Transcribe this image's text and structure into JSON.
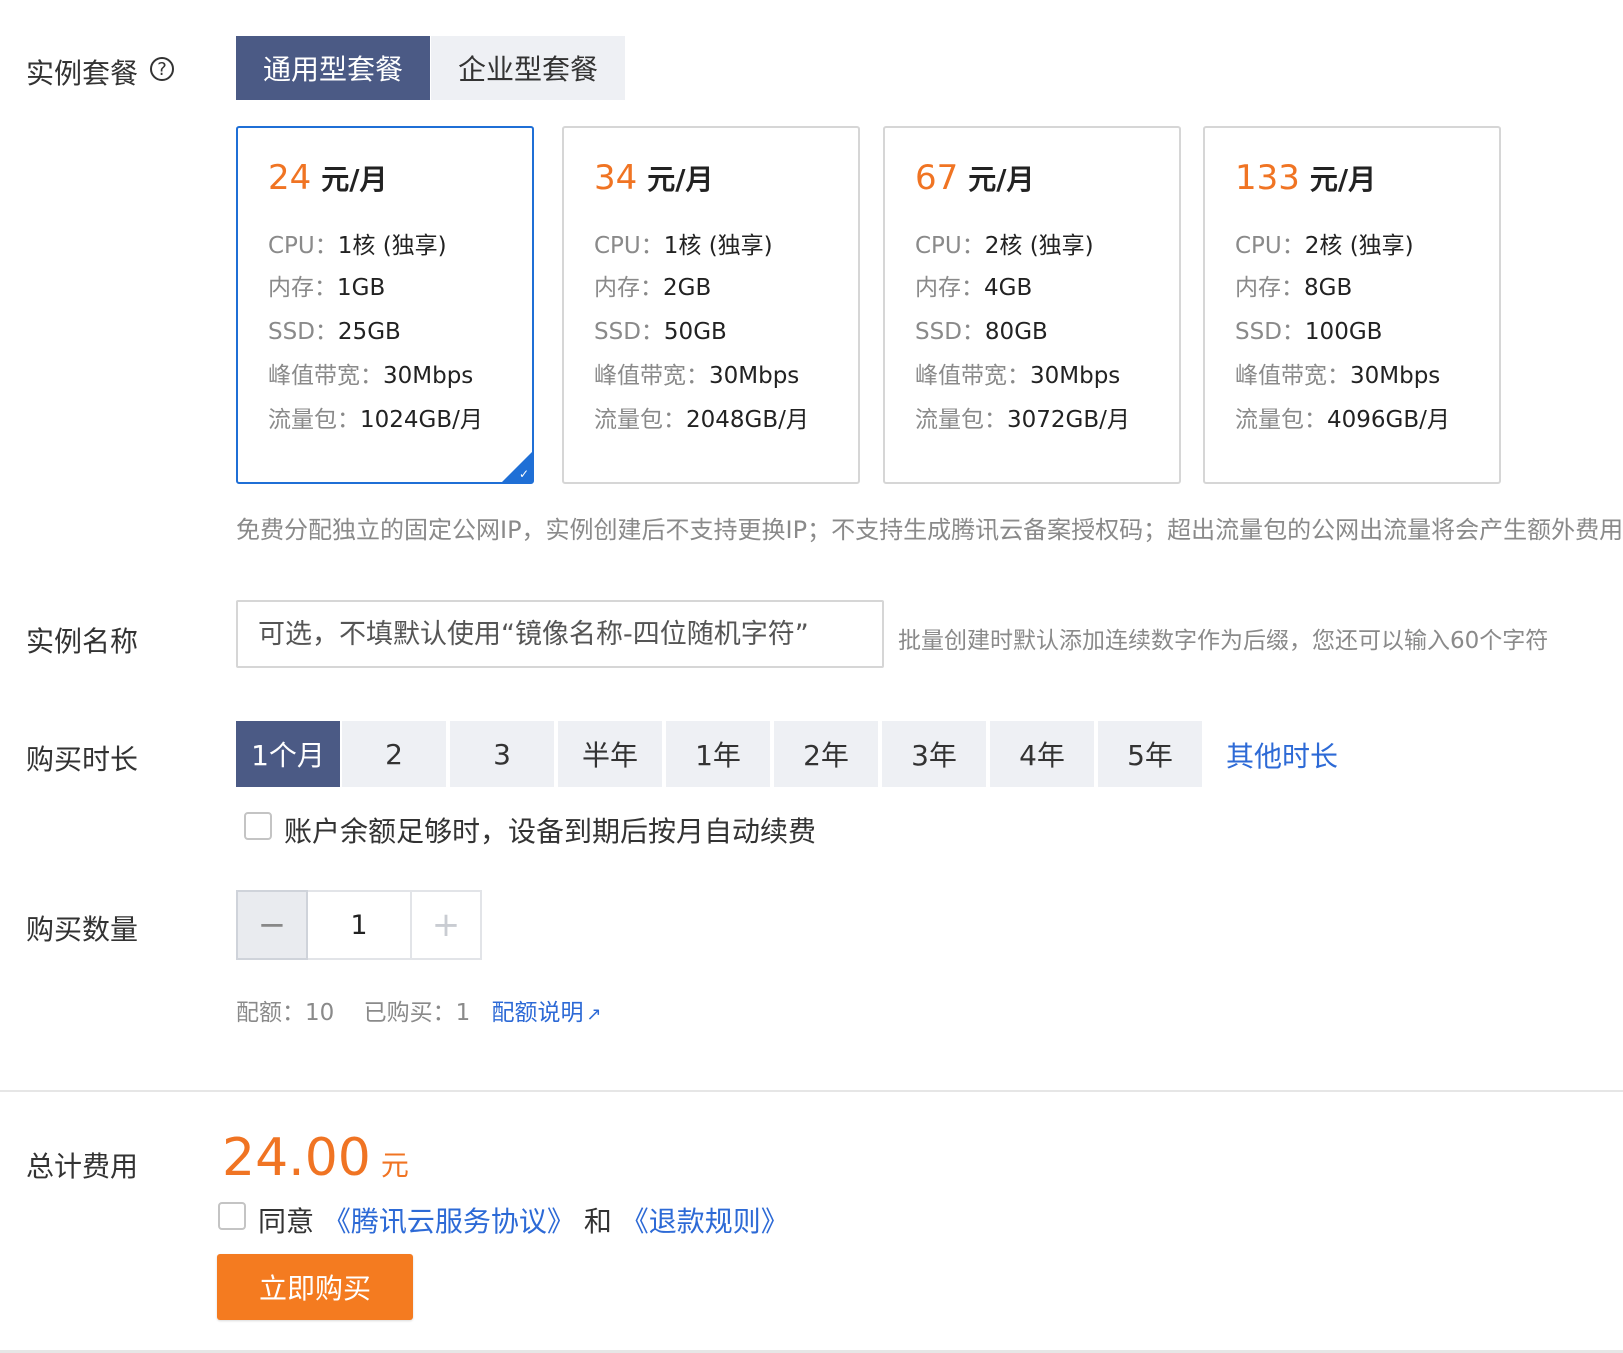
{
  "plan": {
    "label": "实例套餐",
    "help_icon_glyph": "?",
    "tabs": [
      {
        "label": "通用型套餐",
        "active": true
      },
      {
        "label": "企业型套餐",
        "active": false
      }
    ],
    "cards": [
      {
        "price": "24",
        "unit": "元/月",
        "selected": true,
        "specs": [
          {
            "k": "CPU：",
            "v": "1核 (独享)"
          },
          {
            "k": "内存：",
            "v": "1GB"
          },
          {
            "k": "SSD：",
            "v": "25GB"
          },
          {
            "k": "峰值带宽：",
            "v": "30Mbps"
          },
          {
            "k": "流量包：",
            "v": "1024GB/月"
          }
        ]
      },
      {
        "price": "34",
        "unit": "元/月",
        "selected": false,
        "specs": [
          {
            "k": "CPU：",
            "v": "1核 (独享)"
          },
          {
            "k": "内存：",
            "v": "2GB"
          },
          {
            "k": "SSD：",
            "v": "50GB"
          },
          {
            "k": "峰值带宽：",
            "v": "30Mbps"
          },
          {
            "k": "流量包：",
            "v": "2048GB/月"
          }
        ]
      },
      {
        "price": "67",
        "unit": "元/月",
        "selected": false,
        "specs": [
          {
            "k": "CPU：",
            "v": "2核 (独享)"
          },
          {
            "k": "内存：",
            "v": "4GB"
          },
          {
            "k": "SSD：",
            "v": "80GB"
          },
          {
            "k": "峰值带宽：",
            "v": "30Mbps"
          },
          {
            "k": "流量包：",
            "v": "3072GB/月"
          }
        ]
      },
      {
        "price": "133",
        "unit": "元/月",
        "selected": false,
        "specs": [
          {
            "k": "CPU：",
            "v": "2核 (独享)"
          },
          {
            "k": "内存：",
            "v": "8GB"
          },
          {
            "k": "SSD：",
            "v": "100GB"
          },
          {
            "k": "峰值带宽：",
            "v": "30Mbps"
          },
          {
            "k": "流量包：",
            "v": "4096GB/月"
          }
        ]
      }
    ],
    "note": "免费分配独立的固定公网IP，实例创建后不支持更换IP；不支持生成腾讯云备案授权码；超出流量包的公网出流量将会产生额外费用"
  },
  "instance_name": {
    "label": "实例名称",
    "placeholder": "可选，不填默认使用“镜像名称-四位随机字符”",
    "hint": "批量创建时默认添加连续数字作为后缀，您还可以输入60个字符"
  },
  "duration": {
    "label": "购买时长",
    "options": [
      "1个月",
      "2",
      "3",
      "半年",
      "1年",
      "2年",
      "3年",
      "4年",
      "5年"
    ],
    "selected": "1个月",
    "other_label": "其他时长",
    "auto_renew_label": "账户余额足够时，设备到期后按月自动续费"
  },
  "quantity": {
    "label": "购买数量",
    "minus": "−",
    "plus": "+",
    "value": "1",
    "quota_label": "配额：",
    "quota_value": "10",
    "bought_label": "已购买：",
    "bought_value": "1",
    "quota_link": "配额说明",
    "external_icon_glyph": "↗"
  },
  "total": {
    "label": "总计费用",
    "amount": "24.00",
    "currency": "元",
    "agree_prefix": "同意",
    "service_link": "《腾讯云服务协议》",
    "and": "和",
    "refund_link": "《退款规则》",
    "buy_button": "立即购买"
  },
  "colors": {
    "accent_navy": "#4b5a85",
    "price_orange": "#f07423",
    "link_blue": "#2d6ad6",
    "selected_border": "#1f6fd6",
    "buy_orange": "#f47b20"
  }
}
